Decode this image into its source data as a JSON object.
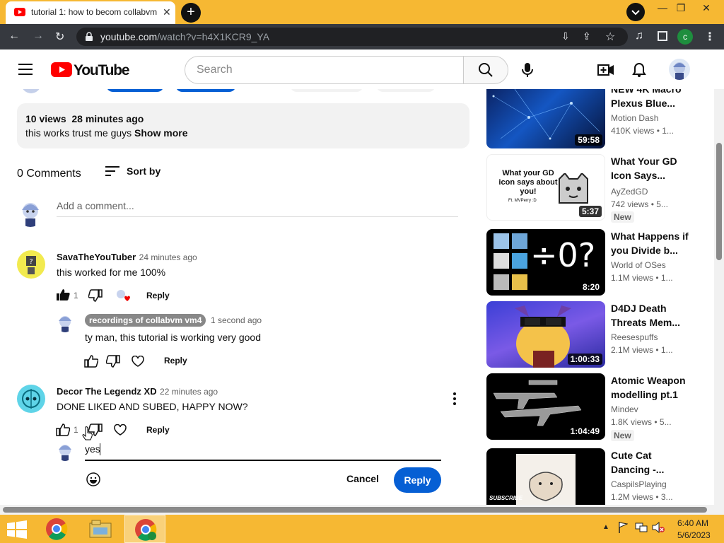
{
  "browser": {
    "tab_title": "tutorial 1: how to becom collabvm",
    "url_host": "youtube.com",
    "url_path": "/watch?v=h4X1KCR9_YA",
    "profile_initial": "c"
  },
  "yt_header": {
    "logo_text": "YouTube",
    "search_placeholder": "Search"
  },
  "description": {
    "views": "10 views",
    "time": "28 minutes ago",
    "text": "this works trust me guys",
    "show_more": "Show more"
  },
  "comments_header": {
    "count": "0 Comments",
    "sort_label": "Sort by",
    "add_comment_placeholder": "Add a comment..."
  },
  "comments": [
    {
      "author": "SavaTheYouTuber",
      "time": "24 minutes ago",
      "text": "this worked for me 100%",
      "likes": "1",
      "reply_label": "Reply"
    },
    {
      "author": "recordings of collabvm vm4",
      "time": "1 second ago",
      "text": "ty man, this tutorial is working very good",
      "reply_label": "Reply"
    },
    {
      "author": "Decor The Legendz XD",
      "time": "22 minutes ago",
      "text": "DONE LIKED AND SUBED, HAPPY NOW?",
      "likes": "1",
      "reply_label": "Reply"
    }
  ],
  "reply_box": {
    "value": "yes",
    "cancel_label": "Cancel",
    "reply_label": "Reply"
  },
  "sidebar": {
    "videos": [
      {
        "title": "NEW 4K Macro Plexus Blue...",
        "channel": "Motion Dash",
        "meta": "410K views • 1...",
        "duration": "59:58"
      },
      {
        "title": "What Your GD Icon Says...",
        "channel": "AyZedGD",
        "meta": "742 views • 5...",
        "duration": "5:37",
        "badge": "New",
        "thumb_text": "What your GD icon says about you!",
        "thumb_sub": "Ft. MVPerry :D"
      },
      {
        "title": "What Happens if you Divide b...",
        "channel": "World of OSes",
        "meta": "1.1M views • 1...",
        "duration": "8:20",
        "thumb_text": "÷0?"
      },
      {
        "title": "D4DJ Death Threats Mem...",
        "channel": "Reesespuffs",
        "meta": "2.1M views • 1...",
        "duration": "1:00:33"
      },
      {
        "title": "Atomic Weapon modelling pt.1",
        "channel": "Mindev",
        "meta": "1.8K views • 5...",
        "duration": "1:04:49",
        "badge": "New"
      },
      {
        "title": "Cute Cat Dancing -...",
        "channel": "CaspilsPlaying",
        "meta": "1.2M views • 3...",
        "thumb_text": "SUBSCRIBE"
      }
    ]
  },
  "taskbar": {
    "time": "6:40 AM",
    "date": "5/6/2023"
  },
  "colors": {
    "accent_blue": "#065fd4",
    "yt_red": "#ff0000",
    "taskbar": "#f6b833"
  }
}
